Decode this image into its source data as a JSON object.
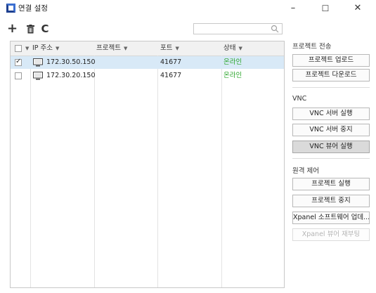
{
  "window": {
    "title": "연결 설정",
    "minimize": "–",
    "maximize": "☐",
    "close": "✕"
  },
  "toolbar": {
    "add": "+",
    "delete": "🗑",
    "refresh": "C",
    "search_placeholder": ""
  },
  "table": {
    "columns": [
      "IP 주소",
      "프로젝트",
      "포트",
      "상태"
    ],
    "rows": [
      {
        "checked": true,
        "ip": "172.30.50.150",
        "project": "",
        "port": "41677",
        "status": "온라인"
      },
      {
        "checked": false,
        "ip": "172.30.20.150",
        "project": "",
        "port": "41677",
        "status": "온라인"
      }
    ]
  },
  "panel": {
    "project_transfer": {
      "label": "프로젝트 전송",
      "upload": "프로젝트 업로드",
      "download": "프로젝트 다운로드"
    },
    "vnc": {
      "label": "VNC",
      "server_run": "VNC 서버 실행",
      "server_stop": "VNC 서버 중지",
      "viewer_run": "VNC 뷰어 실행"
    },
    "remote": {
      "label": "원격 제어",
      "project_run": "프로젝트 실행",
      "project_stop": "프로젝트 중지",
      "software_update": "Xpanel 소프트웨어 업데...",
      "viewer_reboot": "Xpanel 뷰어 재부팅"
    }
  },
  "colors": {
    "selected_row": "#d8e9f7",
    "online": "#2aa52a",
    "active_button": "#dadada"
  }
}
